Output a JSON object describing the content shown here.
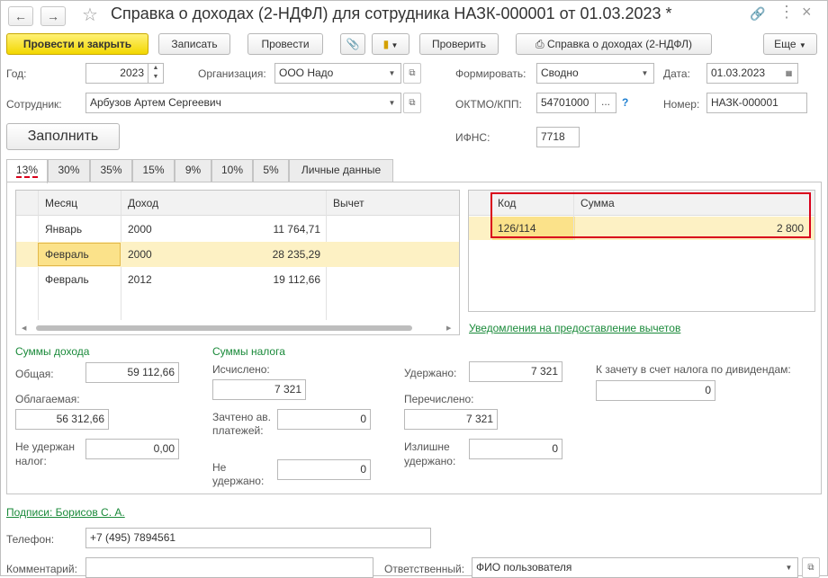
{
  "title": "Справка о доходах (2-НДФЛ) для сотрудника НАЗК-000001 от 01.03.2023 *",
  "toolbar": {
    "post_close": "Провести и закрыть",
    "save": "Записать",
    "post": "Провести",
    "check": "Проверить",
    "print": "Справка о доходах (2-НДФЛ)",
    "more": "Еще"
  },
  "form": {
    "year_label": "Год:",
    "year": "2023",
    "org_label": "Организация:",
    "org": "ООО Надо",
    "form_label": "Формировать:",
    "form_value": "Сводно",
    "date_label": "Дата:",
    "date": "01.03.2023",
    "employee_label": "Сотрудник:",
    "employee": "Арбузов Артем Сергеевич",
    "oktmo_label": "ОКТМО/КПП:",
    "oktmo": "54701000",
    "oktmo_more": "...",
    "help": "?",
    "number_label": "Номер:",
    "number": "НАЗК-000001",
    "fill_button": "Заполнить",
    "ifns_label": "ИФНС:",
    "ifns": "7718"
  },
  "tabs": [
    "13%",
    "30%",
    "35%",
    "15%",
    "9%",
    "10%",
    "5%",
    "Личные данные"
  ],
  "income_table": {
    "headers": [
      "Месяц",
      "Доход",
      "",
      "Вычет"
    ],
    "rows": [
      {
        "month": "Январь",
        "code": "2000",
        "amount": "11 764,71",
        "deduction": ""
      },
      {
        "month": "Февраль",
        "code": "2000",
        "amount": "28 235,29",
        "deduction": ""
      },
      {
        "month": "Февраль",
        "code": "2012",
        "amount": "19 112,66",
        "deduction": ""
      }
    ]
  },
  "deduction_table": {
    "headers": [
      "Код",
      "Сумма"
    ],
    "rows": [
      {
        "code": "126/114",
        "amount": "2 800"
      }
    ]
  },
  "notices_link": "Уведомления на предоставление вычетов",
  "income_sums": {
    "title": "Суммы дохода",
    "total_label": "Общая:",
    "total": "59 112,66",
    "taxable_label": "Облагаемая:",
    "taxable": "56 312,66",
    "not_withheld_label": "Не удержан налог:",
    "not_withheld": "0,00"
  },
  "tax_sums": {
    "title": "Суммы налога",
    "calculated_label": "Исчислено:",
    "calculated": "7 321",
    "credited_label": "Зачтено ав. платежей:",
    "credited": "0",
    "not_withheld_label": "Не удержано:",
    "not_withheld": "0",
    "withheld_label": "Удержано:",
    "withheld": "7 321",
    "transferred_label": "Перечислено:",
    "transferred": "7 321",
    "excess_label": "Излишне удержано:",
    "excess": "0",
    "dividend_label": "К зачету в счет налога по дивидендам:",
    "dividend": "0"
  },
  "signatures_link": "Подписи: Борисов С. А.",
  "phone_label": "Телефон:",
  "phone": "+7 (495) 7894561",
  "comment_label": "Комментарий:",
  "comment": "",
  "responsible_label": "Ответственный:",
  "responsible": "ФИО пользователя",
  "colors": {
    "accent_yellow": "#f2d700",
    "selected_row": "#fdf1c4",
    "highlight_border": "#d9001b",
    "link_green": "#1a8a3a"
  }
}
